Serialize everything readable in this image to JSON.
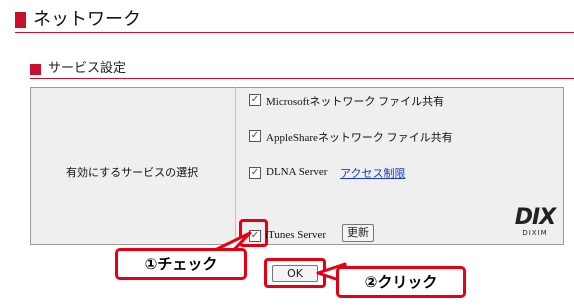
{
  "page": {
    "title": "ネットワーク"
  },
  "section": {
    "title": "サービス設定"
  },
  "services": {
    "label": "有効にするサービスの選択",
    "items": [
      {
        "label": "Microsoftネットワーク ファイル共有",
        "checked": true
      },
      {
        "label": "AppleShareネットワーク ファイル共有",
        "checked": true
      },
      {
        "label": "DLNA Server",
        "checked": true,
        "link": "アクセス制限"
      },
      {
        "label": "iTunes Server",
        "checked": true,
        "button": "更新"
      }
    ]
  },
  "logo": {
    "mark": "DIX",
    "text": "DIXIM"
  },
  "ok_button": "OK",
  "callouts": {
    "check": "①チェック",
    "click": "②クリック"
  },
  "colors": {
    "accent": "#c8102e",
    "callout_border": "#e60012",
    "link": "#1b39c8"
  }
}
